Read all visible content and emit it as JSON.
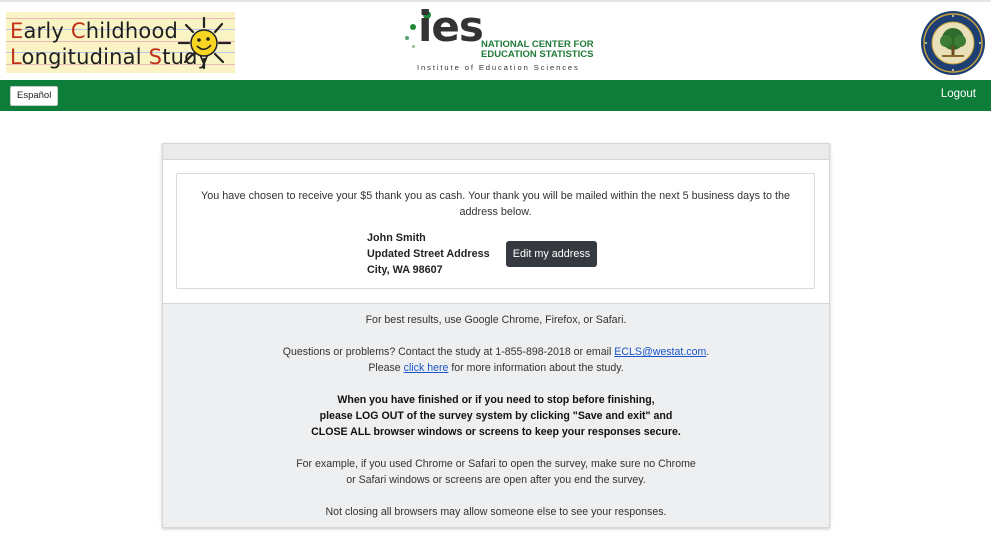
{
  "header": {
    "ecls_logo": {
      "line1_caps": "E",
      "line1_a": "arly ",
      "line1_caps2": "C",
      "line1_b": "hildhood",
      "line2_caps": "L",
      "line2_a": "ongitudinal ",
      "line2_caps2": "S",
      "line2_b": "tudy"
    },
    "ies_logo": {
      "letters": "ies",
      "nces_line1": "NATIONAL CENTER FOR",
      "nces_line2": "EDUCATION STATISTICS",
      "subtitle": "Institute of Education Sciences"
    },
    "seal": {
      "text": "DEPARTMENT OF EDUCATION · UNITED STATES OF AMERICA"
    }
  },
  "navbar": {
    "language_button": "Español",
    "logout_link": "Logout"
  },
  "notice": {
    "message": "You have chosen to receive your $5 thank you as cash. Your thank you will be mailed within the next 5 business days to the address below.",
    "address": {
      "name": "John Smith",
      "street": "Updated Street Address",
      "city_line": "City, WA 98607"
    },
    "edit_button": "Edit my address"
  },
  "footer": {
    "browsers": "For best results, use Google Chrome, Firefox, or Safari.",
    "questions_prefix": "Questions or problems? Contact the study at 1-855-898-2018 or email ",
    "email_link": "ECLS@westat.com",
    "questions_suffix": ".",
    "please_prefix": "Please ",
    "click_here_link": "click here",
    "please_suffix": " for more information about the study.",
    "logout_line1": "When you have finished or if you need to stop before finishing,",
    "logout_line2": "please LOG OUT of the survey system by clicking \"Save and exit\" and",
    "logout_line3": "CLOSE ALL browser windows or screens to keep your responses secure.",
    "example_line1": "For example, if you used Chrome or Safari to open the survey, make sure no Chrome",
    "example_line2": "or Safari windows or screens are open after you end the survey.",
    "warning": "Not closing all browsers may allow someone else to see your responses."
  },
  "colors": {
    "navbar": "#0f7d3a",
    "edit_button": "#343a40",
    "link": "#1a56c9"
  }
}
